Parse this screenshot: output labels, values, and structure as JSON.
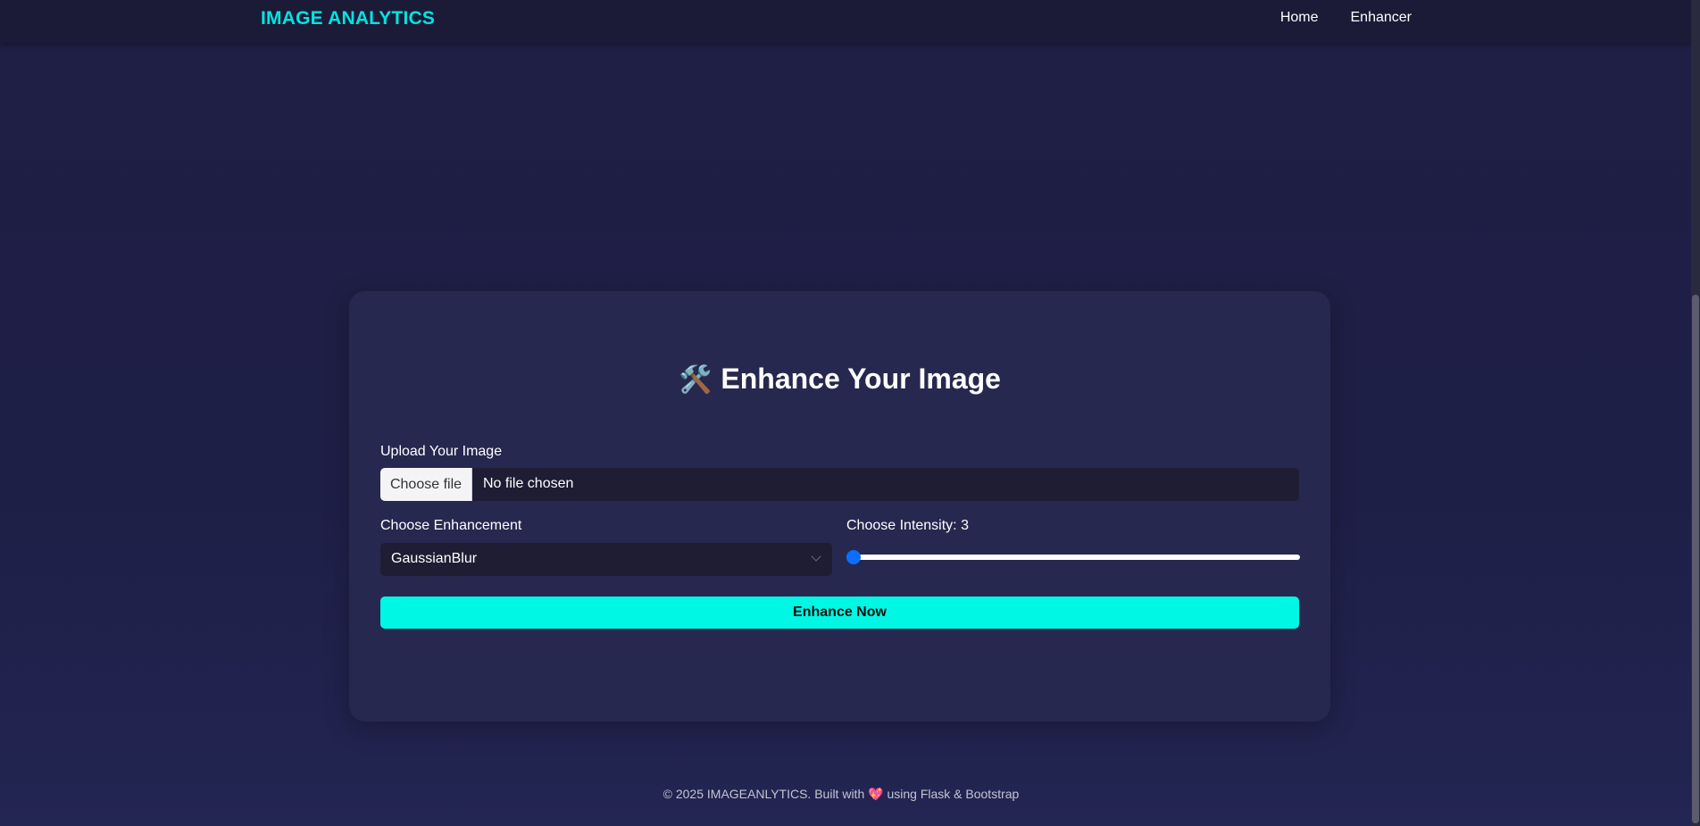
{
  "navbar": {
    "brand": "IMAGE ANALYTICS",
    "links": [
      {
        "label": "Home"
      },
      {
        "label": "Enhancer"
      }
    ]
  },
  "card": {
    "title_icon": "🛠️",
    "title": "Enhance Your Image",
    "upload": {
      "label": "Upload Your Image",
      "button_label": "Choose file",
      "status": "No file chosen"
    },
    "enhancement": {
      "label": "Choose Enhancement",
      "selected": "GaussianBlur",
      "icon": "chevron-down-icon"
    },
    "intensity": {
      "label": "Choose Intensity: 3",
      "value": 3,
      "min": 3,
      "max": 100
    },
    "submit_label": "Enhance Now"
  },
  "footer": {
    "text_before": "© 2025 IMAGEANLYTICS. Built with",
    "heart": "💖",
    "text_after": "using Flask & Bootstrap"
  },
  "colors": {
    "brand": "#00e5e0",
    "accent_button": "#00f7e4",
    "slider_thumb": "#0d6efd",
    "background": "#1f1f45",
    "card": "#27284f"
  }
}
